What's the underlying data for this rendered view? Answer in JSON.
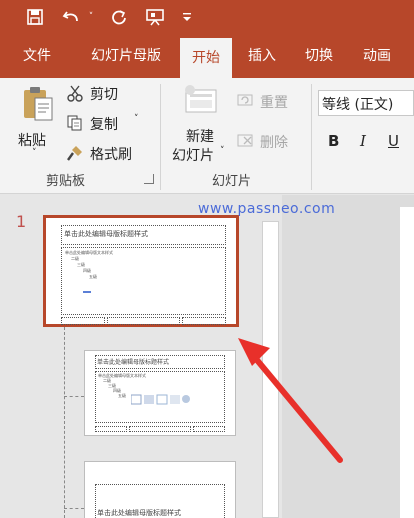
{
  "qat": {
    "icons": [
      "save-icon",
      "undo-icon",
      "redo-icon",
      "present-icon",
      "customize-icon"
    ]
  },
  "tabs": [
    {
      "label": "文件"
    },
    {
      "label": "幻灯片母版"
    },
    {
      "label": "开始"
    },
    {
      "label": "插入"
    },
    {
      "label": "切换"
    },
    {
      "label": "动画"
    }
  ],
  "ribbon": {
    "clipboard": {
      "paste": "粘贴",
      "cut": "剪切",
      "copy": "复制",
      "format_painter": "格式刷",
      "group_label": "剪贴板"
    },
    "slides": {
      "new_slide_line1": "新建",
      "new_slide_line2": "幻灯片",
      "reset": "重置",
      "delete": "删除",
      "group_label": "幻灯片"
    },
    "font": {
      "font_name": "等线 (正文)",
      "bold": "B",
      "italic": "I",
      "underline": "U"
    }
  },
  "pane": {
    "watermark": "www.passneo.com",
    "slide_number": "1",
    "master": {
      "title": "单击此处编辑母版标题样式",
      "body": [
        "单击此处编辑母版文本样式",
        "二级",
        "三级",
        "四级",
        "五级"
      ]
    },
    "layout1": {
      "title": "单击此处编辑母版标题样式",
      "body": [
        "单击此处编辑母版文本样式",
        "二级",
        "三级",
        "四级",
        "五级"
      ]
    },
    "layout2": {
      "title": "单击此处编辑母版标题样式"
    }
  },
  "colors": {
    "accent": "#b7472a",
    "selection": "#b7472a",
    "arrow": "#e8302a"
  }
}
